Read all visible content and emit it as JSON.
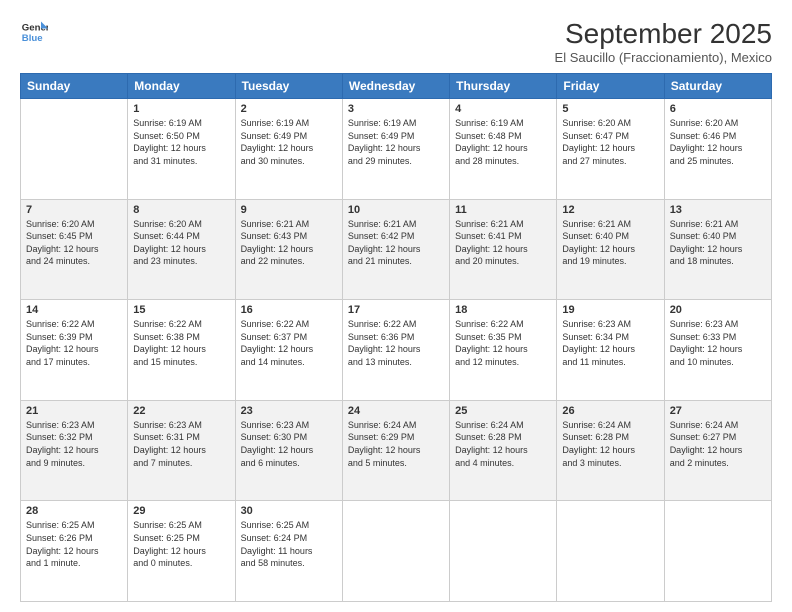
{
  "logo": {
    "line1": "General",
    "line2": "Blue"
  },
  "title": "September 2025",
  "subtitle": "El Saucillo (Fraccionamiento), Mexico",
  "days_of_week": [
    "Sunday",
    "Monday",
    "Tuesday",
    "Wednesday",
    "Thursday",
    "Friday",
    "Saturday"
  ],
  "weeks": [
    [
      {
        "day": "",
        "info": ""
      },
      {
        "day": "1",
        "info": "Sunrise: 6:19 AM\nSunset: 6:50 PM\nDaylight: 12 hours\nand 31 minutes."
      },
      {
        "day": "2",
        "info": "Sunrise: 6:19 AM\nSunset: 6:49 PM\nDaylight: 12 hours\nand 30 minutes."
      },
      {
        "day": "3",
        "info": "Sunrise: 6:19 AM\nSunset: 6:49 PM\nDaylight: 12 hours\nand 29 minutes."
      },
      {
        "day": "4",
        "info": "Sunrise: 6:19 AM\nSunset: 6:48 PM\nDaylight: 12 hours\nand 28 minutes."
      },
      {
        "day": "5",
        "info": "Sunrise: 6:20 AM\nSunset: 6:47 PM\nDaylight: 12 hours\nand 27 minutes."
      },
      {
        "day": "6",
        "info": "Sunrise: 6:20 AM\nSunset: 6:46 PM\nDaylight: 12 hours\nand 25 minutes."
      }
    ],
    [
      {
        "day": "7",
        "info": "Sunrise: 6:20 AM\nSunset: 6:45 PM\nDaylight: 12 hours\nand 24 minutes."
      },
      {
        "day": "8",
        "info": "Sunrise: 6:20 AM\nSunset: 6:44 PM\nDaylight: 12 hours\nand 23 minutes."
      },
      {
        "day": "9",
        "info": "Sunrise: 6:21 AM\nSunset: 6:43 PM\nDaylight: 12 hours\nand 22 minutes."
      },
      {
        "day": "10",
        "info": "Sunrise: 6:21 AM\nSunset: 6:42 PM\nDaylight: 12 hours\nand 21 minutes."
      },
      {
        "day": "11",
        "info": "Sunrise: 6:21 AM\nSunset: 6:41 PM\nDaylight: 12 hours\nand 20 minutes."
      },
      {
        "day": "12",
        "info": "Sunrise: 6:21 AM\nSunset: 6:40 PM\nDaylight: 12 hours\nand 19 minutes."
      },
      {
        "day": "13",
        "info": "Sunrise: 6:21 AM\nSunset: 6:40 PM\nDaylight: 12 hours\nand 18 minutes."
      }
    ],
    [
      {
        "day": "14",
        "info": "Sunrise: 6:22 AM\nSunset: 6:39 PM\nDaylight: 12 hours\nand 17 minutes."
      },
      {
        "day": "15",
        "info": "Sunrise: 6:22 AM\nSunset: 6:38 PM\nDaylight: 12 hours\nand 15 minutes."
      },
      {
        "day": "16",
        "info": "Sunrise: 6:22 AM\nSunset: 6:37 PM\nDaylight: 12 hours\nand 14 minutes."
      },
      {
        "day": "17",
        "info": "Sunrise: 6:22 AM\nSunset: 6:36 PM\nDaylight: 12 hours\nand 13 minutes."
      },
      {
        "day": "18",
        "info": "Sunrise: 6:22 AM\nSunset: 6:35 PM\nDaylight: 12 hours\nand 12 minutes."
      },
      {
        "day": "19",
        "info": "Sunrise: 6:23 AM\nSunset: 6:34 PM\nDaylight: 12 hours\nand 11 minutes."
      },
      {
        "day": "20",
        "info": "Sunrise: 6:23 AM\nSunset: 6:33 PM\nDaylight: 12 hours\nand 10 minutes."
      }
    ],
    [
      {
        "day": "21",
        "info": "Sunrise: 6:23 AM\nSunset: 6:32 PM\nDaylight: 12 hours\nand 9 minutes."
      },
      {
        "day": "22",
        "info": "Sunrise: 6:23 AM\nSunset: 6:31 PM\nDaylight: 12 hours\nand 7 minutes."
      },
      {
        "day": "23",
        "info": "Sunrise: 6:23 AM\nSunset: 6:30 PM\nDaylight: 12 hours\nand 6 minutes."
      },
      {
        "day": "24",
        "info": "Sunrise: 6:24 AM\nSunset: 6:29 PM\nDaylight: 12 hours\nand 5 minutes."
      },
      {
        "day": "25",
        "info": "Sunrise: 6:24 AM\nSunset: 6:28 PM\nDaylight: 12 hours\nand 4 minutes."
      },
      {
        "day": "26",
        "info": "Sunrise: 6:24 AM\nSunset: 6:28 PM\nDaylight: 12 hours\nand 3 minutes."
      },
      {
        "day": "27",
        "info": "Sunrise: 6:24 AM\nSunset: 6:27 PM\nDaylight: 12 hours\nand 2 minutes."
      }
    ],
    [
      {
        "day": "28",
        "info": "Sunrise: 6:25 AM\nSunset: 6:26 PM\nDaylight: 12 hours\nand 1 minute."
      },
      {
        "day": "29",
        "info": "Sunrise: 6:25 AM\nSunset: 6:25 PM\nDaylight: 12 hours\nand 0 minutes."
      },
      {
        "day": "30",
        "info": "Sunrise: 6:25 AM\nSunset: 6:24 PM\nDaylight: 11 hours\nand 58 minutes."
      },
      {
        "day": "",
        "info": ""
      },
      {
        "day": "",
        "info": ""
      },
      {
        "day": "",
        "info": ""
      },
      {
        "day": "",
        "info": ""
      }
    ]
  ]
}
